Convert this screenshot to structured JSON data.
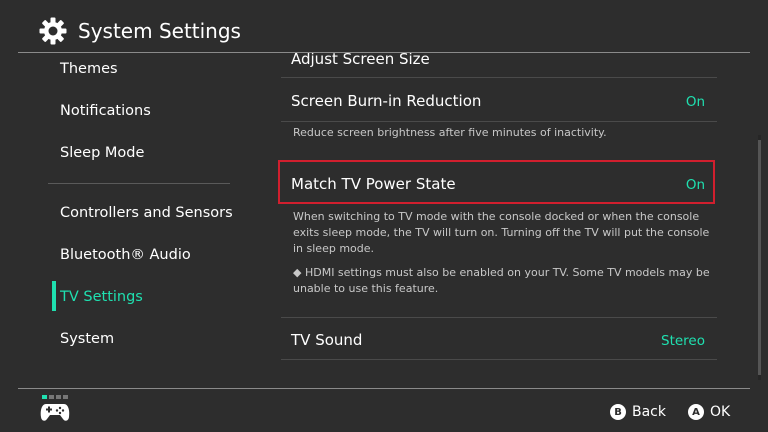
{
  "header": {
    "title": "System Settings",
    "icon": "gear-icon"
  },
  "sidebar": {
    "items": [
      {
        "label": "Themes",
        "active": false
      },
      {
        "label": "Notifications",
        "active": false
      },
      {
        "label": "Sleep Mode",
        "active": false
      },
      {
        "label": "Controllers and Sensors",
        "active": false
      },
      {
        "label": "Bluetooth® Audio",
        "active": false
      },
      {
        "label": "TV Settings",
        "active": true
      },
      {
        "label": "System",
        "active": false
      }
    ]
  },
  "content": {
    "rows": [
      {
        "title": "Adjust Screen Size",
        "value": ""
      },
      {
        "title": "Screen Burn-in Reduction",
        "value": "On",
        "description": "Reduce screen brightness after five minutes of inactivity."
      },
      {
        "title": "Match TV Power State",
        "value": "On",
        "description": "When switching to TV mode with the console docked or when the console exits sleep mode, the TV will turn on. Turning off the TV will put the console in sleep mode.",
        "note": "◆ HDMI settings must also be enabled on your TV. Some TV models may be unable to use this feature."
      },
      {
        "title": "TV Sound",
        "value": "Stereo"
      }
    ]
  },
  "footer": {
    "back": {
      "button": "B",
      "label": "Back"
    },
    "ok": {
      "button": "A",
      "label": "OK"
    }
  },
  "colors": {
    "accent": "#1fe0b0",
    "selection": "#d11f2e",
    "background": "#2d2d2d"
  }
}
